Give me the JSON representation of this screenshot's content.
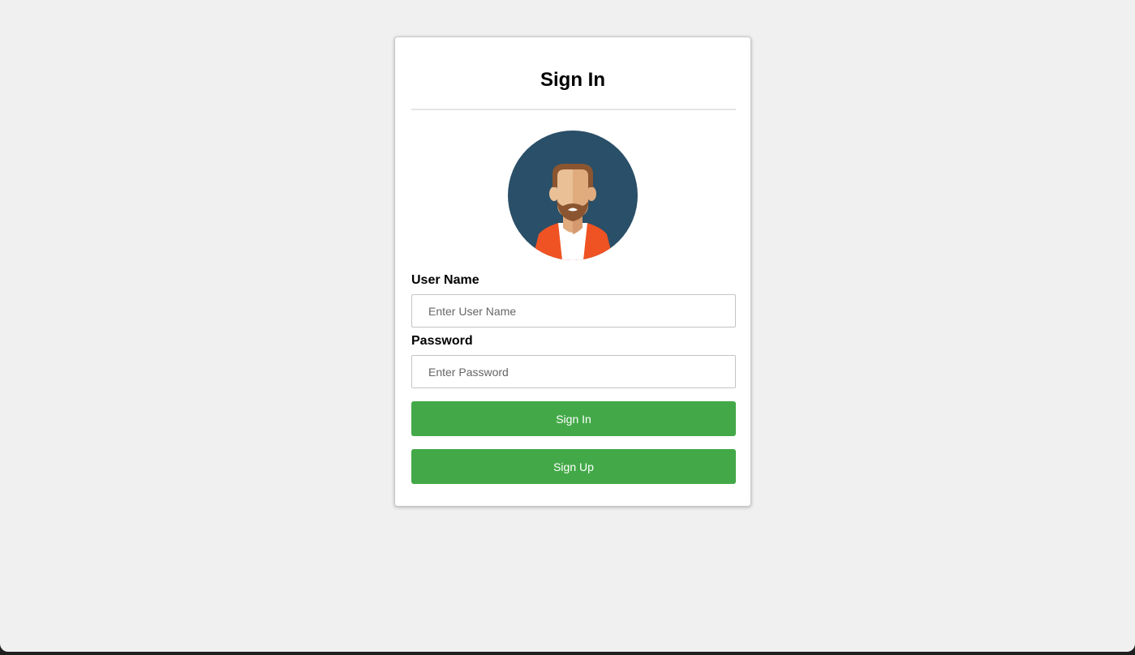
{
  "form": {
    "title": "Sign In",
    "username_label": "User Name",
    "username_placeholder": "Enter User Name",
    "username_value": "",
    "password_label": "Password",
    "password_placeholder": "Enter Password",
    "password_value": "",
    "signin_button": "Sign In",
    "signup_button": "Sign Up"
  },
  "avatar": {
    "icon": "user-avatar-icon",
    "background_color": "#2a4f68",
    "hair_color": "#8a5530",
    "skin_color": "#eac096",
    "shirt_color": "#ffffff",
    "jacket_color": "#f05323"
  },
  "colors": {
    "page_background": "#f0f0f0",
    "button": "#43a948",
    "button_text": "#ffffff"
  }
}
